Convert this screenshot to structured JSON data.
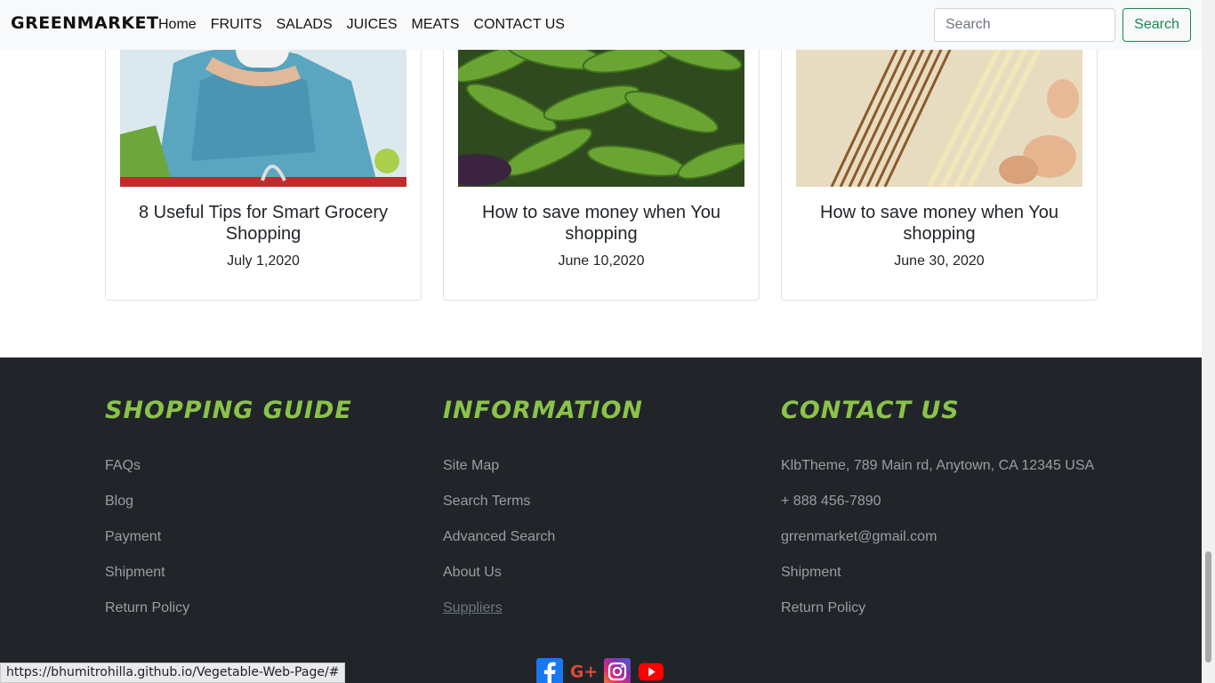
{
  "navbar": {
    "brand": "GREENMARKET",
    "links": [
      "Home",
      "FRUITS",
      "SALADS",
      "JUICES",
      "MEATS",
      "CONTACT US"
    ],
    "search_placeholder": "Search",
    "search_button": "Search"
  },
  "cards": [
    {
      "title": "8 Useful Tips for Smart Grocery Shopping",
      "date": "July 1,2020"
    },
    {
      "title": "How to save money when You shopping",
      "date": "June 10,2020"
    },
    {
      "title": "How to save money when You shopping",
      "date": "June 30, 2020"
    }
  ],
  "footer": {
    "shopping_guide": {
      "heading": "SHOPPING GUIDE",
      "items": [
        "FAQs",
        "Blog",
        "Payment",
        "Shipment",
        "Return Policy"
      ]
    },
    "information": {
      "heading": "INFORMATION",
      "items": [
        "Site Map",
        "Search Terms",
        "Advanced Search",
        "About Us",
        "Suppliers"
      ]
    },
    "contact": {
      "heading": "CONTACT US",
      "items": [
        "KlbTheme, 789 Main rd, Anytown, CA 12345 USA",
        "+ 888 456-7890",
        "grrenmarket@gmail.com",
        "Shipment",
        "Return Policy"
      ]
    },
    "social": [
      "facebook-icon",
      "google-plus-icon",
      "instagram-icon",
      "youtube-icon"
    ]
  },
  "status_url": "https://bhumitrohilla.github.io/Vegetable-Web-Page/#",
  "colors": {
    "accent_green": "#8bc34a",
    "footer_bg": "#212529",
    "button_green": "#198754"
  }
}
